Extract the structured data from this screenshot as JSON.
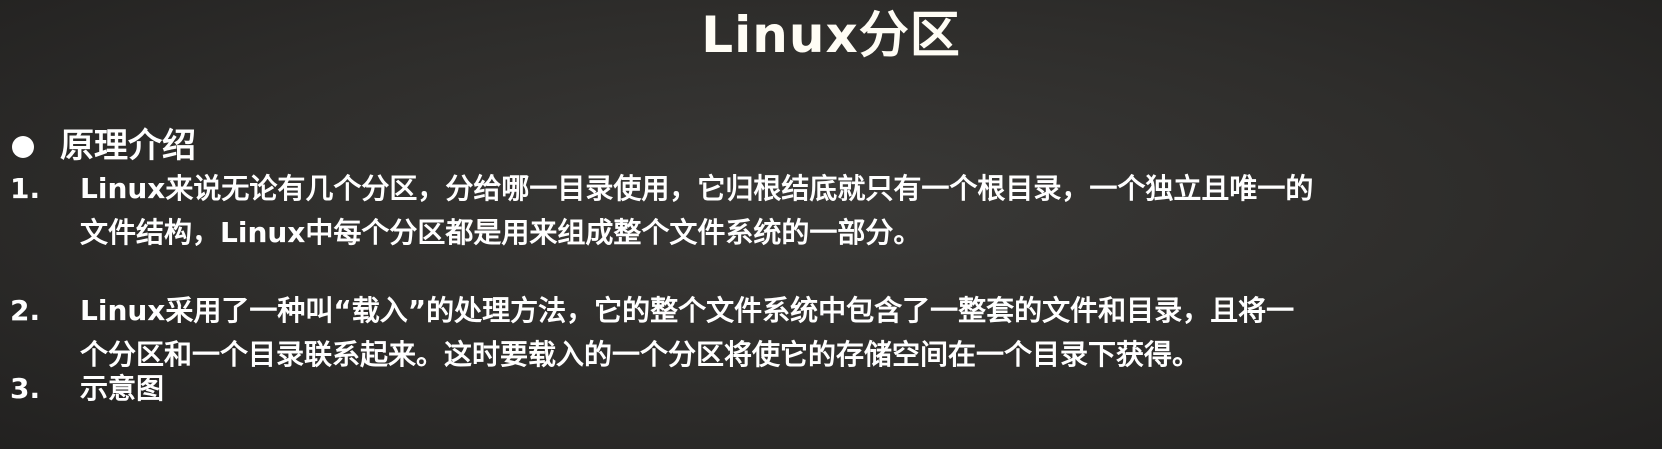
{
  "slide": {
    "title": "Linux分区",
    "section_heading": "原理介绍",
    "items": [
      {
        "number": "1.",
        "lines": [
          "Linux来说无论有几个分区，分给哪一目录使用，它归根结底就只有一个根目录，一个独立且唯一的",
          "文件结构，Linux中每个分区都是用来组成整个文件系统的一部分。"
        ]
      },
      {
        "number": "2.",
        "lines": [
          "Linux采用了一种叫“载入”的处理方法，它的整个文件系统中包含了一整套的文件和目录，且将一",
          "个分区和一个目录联系起来。这时要载入的一个分区将使它的存储空间在一个目录下获得。"
        ]
      },
      {
        "number": "3.",
        "lines": [
          "示意图"
        ]
      }
    ]
  }
}
